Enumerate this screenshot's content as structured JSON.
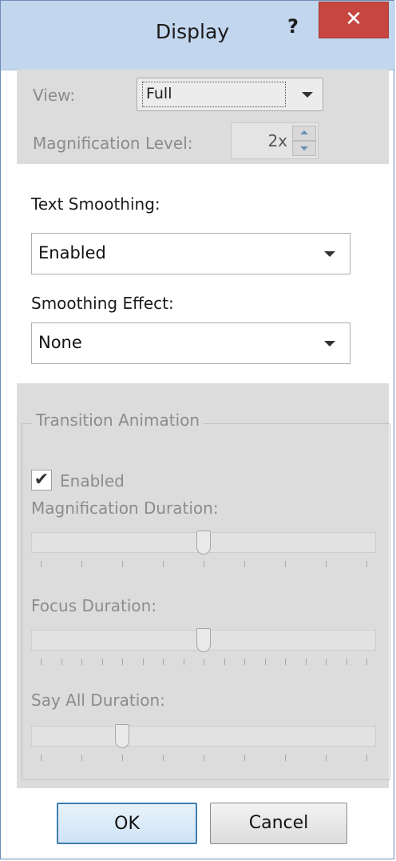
{
  "window": {
    "title": "Display",
    "help_label": "?",
    "close_label": "✕"
  },
  "view": {
    "label": "View:",
    "value": "Full"
  },
  "magnification": {
    "label": "Magnification Level:",
    "value": "2x"
  },
  "text_smoothing": {
    "label": "Text Smoothing:",
    "value": "Enabled"
  },
  "smoothing_effect": {
    "label": "Smoothing Effect:",
    "value": "None"
  },
  "transition": {
    "group_title": "Transition Animation",
    "enabled_label": "Enabled",
    "enabled_checked": true,
    "sliders": [
      {
        "label": "Magnification Duration:",
        "value_fraction": 0.5
      },
      {
        "label": "Focus Duration:",
        "value_fraction": 0.5
      },
      {
        "label": "Say All Duration:",
        "value_fraction": 0.25
      }
    ]
  },
  "buttons": {
    "ok": "OK",
    "cancel": "Cancel"
  },
  "colors": {
    "titlebar": "#c2d6ee",
    "close": "#c7463f",
    "disabled_panel": "#dcdcdc",
    "ok_border": "#3c7fb1"
  }
}
